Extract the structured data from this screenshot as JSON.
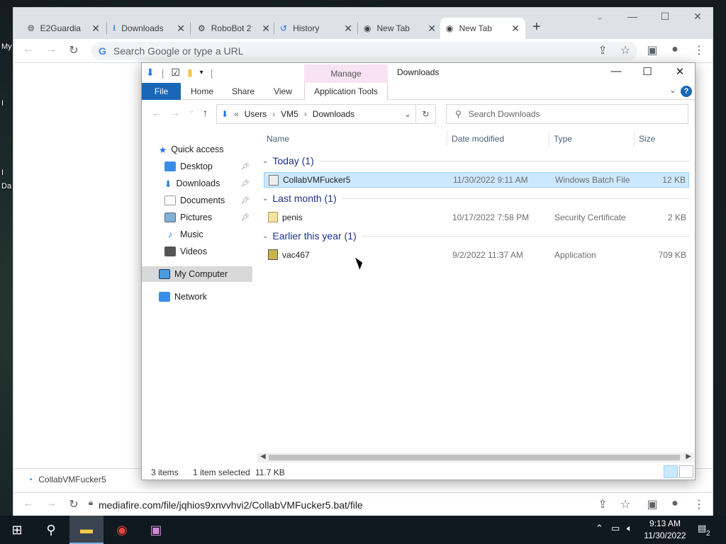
{
  "desktop": {
    "labels": [
      "My",
      "I",
      "I",
      "Da"
    ]
  },
  "chrome": {
    "tabs": [
      {
        "title": "E2Guardia",
        "icon": "globe-icon"
      },
      {
        "title": "Downloads",
        "icon": "download-icon"
      },
      {
        "title": "RoboBot 2",
        "icon": "robot-icon"
      },
      {
        "title": "History",
        "icon": "history-icon"
      },
      {
        "title": "New Tab",
        "icon": "chrome-icon"
      },
      {
        "title": "New Tab",
        "icon": "chrome-icon"
      }
    ],
    "omnibox_placeholder": "Search Google or type a URL",
    "omnibox_g": "G",
    "download_item": "CollabVMFucker5",
    "bottom_url": "mediafire.com/file/jqhios9xnvvhvi2/CollabVMFucker5.bat/file"
  },
  "explorer": {
    "manage_label": "Manage",
    "title": "Downloads",
    "ribbon_tabs": {
      "file": "File",
      "home": "Home",
      "share": "Share",
      "view": "View",
      "app_tools": "Application Tools"
    },
    "breadcrumb": {
      "prefix": "«",
      "parts": [
        "Users",
        "VM5",
        "Downloads"
      ]
    },
    "search_placeholder": "Search Downloads",
    "nav": {
      "quick_access": "Quick access",
      "items": [
        {
          "label": "Desktop",
          "pinned": true
        },
        {
          "label": "Downloads",
          "pinned": true
        },
        {
          "label": "Documents",
          "pinned": true
        },
        {
          "label": "Pictures",
          "pinned": true
        },
        {
          "label": "Music",
          "pinned": false
        },
        {
          "label": "Videos",
          "pinned": false
        }
      ],
      "my_computer": "My Computer",
      "network": "Network"
    },
    "columns": {
      "name": "Name",
      "date": "Date modified",
      "type": "Type",
      "size": "Size"
    },
    "groups": [
      {
        "title": "Today (1)",
        "files": [
          {
            "name": "CollabVMFucker5",
            "date": "11/30/2022 9:11 AM",
            "type": "Windows Batch File",
            "size": "12 KB",
            "selected": true
          }
        ]
      },
      {
        "title": "Last month (1)",
        "files": [
          {
            "name": "penis",
            "date": "10/17/2022 7:58 PM",
            "type": "Security Certificate",
            "size": "2 KB",
            "selected": false
          }
        ]
      },
      {
        "title": "Earlier this year (1)",
        "files": [
          {
            "name": "vac467",
            "date": "9/2/2022 11:37 AM",
            "type": "Application",
            "size": "709 KB",
            "selected": false
          }
        ]
      }
    ],
    "status": {
      "items": "3 items",
      "selected": "1 item selected",
      "size": "11.7 KB"
    }
  },
  "taskbar": {
    "clock_time": "9:13 AM",
    "clock_date": "11/30/2022",
    "notification_count": "2"
  },
  "colors": {
    "accent": "#1a67b8",
    "selection": "#cce8ff",
    "group_header": "#1e3287"
  }
}
